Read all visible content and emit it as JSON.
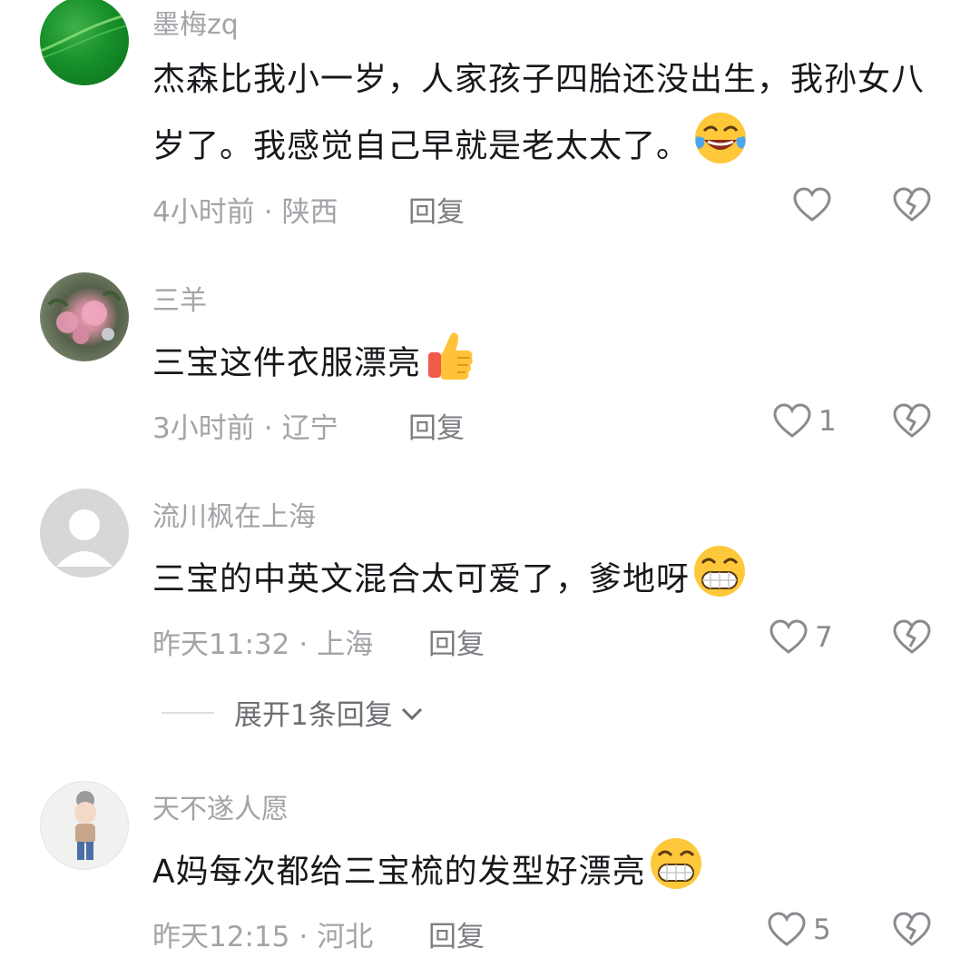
{
  "comments": [
    {
      "username": "墨梅zq",
      "text": "杰森比我小一岁，人家孩子四胎还没出生，我孙女八岁了。我感觉自己早就是老太太了。",
      "emoji": "laugh-cry-emoji",
      "time": "4小时前",
      "location": "陕西",
      "reply_label": "回复",
      "likes": ""
    },
    {
      "username": "三羊",
      "text": "三宝这件衣服漂亮",
      "emoji": "thumbs-up-emoji",
      "time": "3小时前",
      "location": "辽宁",
      "reply_label": "回复",
      "likes": "1"
    },
    {
      "username": "流川枫在上海",
      "text": "三宝的中英文混合太可爱了，爹地呀",
      "emoji": "grin-emoji",
      "time": "昨天11:32",
      "location": "上海",
      "reply_label": "回复",
      "likes": "7",
      "expand_label": "展开1条回复"
    },
    {
      "username": "天不遂人愿",
      "text": "A妈每次都给三宝梳的发型好漂亮",
      "emoji": "grin-emoji",
      "time": "昨天12:15",
      "location": "河北",
      "reply_label": "回复",
      "likes": "5"
    }
  ],
  "separator": "·",
  "colors": {
    "primary_text": "#17181c",
    "secondary_text": "#a3a3a8",
    "icon": "#8a8a90"
  }
}
